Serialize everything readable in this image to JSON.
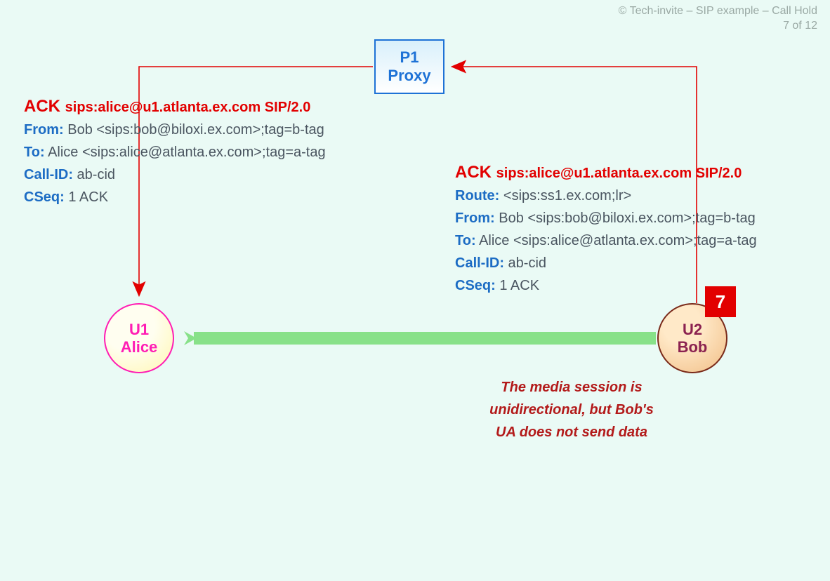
{
  "attribution": {
    "line1": "© Tech-invite – SIP example – Call Hold",
    "line2": "7 of 12"
  },
  "proxy": {
    "l1": "P1",
    "l2": "Proxy"
  },
  "alice": {
    "l1": "U1",
    "l2": "Alice"
  },
  "bob": {
    "l1": "U2",
    "l2": "Bob"
  },
  "step_number": "7",
  "msg_left": {
    "method": "ACK",
    "request_uri": "sips:alice@u1.atlanta.ex.com SIP/2.0",
    "from_k": "From:",
    "from_v": " Bob <sips:bob@biloxi.ex.com>;tag=b-tag",
    "to_k": "To:",
    "to_v": " Alice <sips:alice@atlanta.ex.com>;tag=a-tag",
    "cid_k": "Call-ID:",
    "cid_v": " ab-cid",
    "cseq_k": "CSeq:",
    "cseq_v": " 1 ACK"
  },
  "msg_right": {
    "method": "ACK",
    "request_uri": "sips:alice@u1.atlanta.ex.com SIP/2.0",
    "route_k": "Route:",
    "route_v": " <sips:ss1.ex.com;lr>",
    "from_k": "From:",
    "from_v": " Bob <sips:bob@biloxi.ex.com>;tag=b-tag",
    "to_k": "To:",
    "to_v": " Alice <sips:alice@atlanta.ex.com>;tag=a-tag",
    "cid_k": "Call-ID:",
    "cid_v": " ab-cid",
    "cseq_k": "CSeq:",
    "cseq_v": " 1 ACK"
  },
  "media_note": "The media session is unidirectional, but Bob's UA does not send data"
}
